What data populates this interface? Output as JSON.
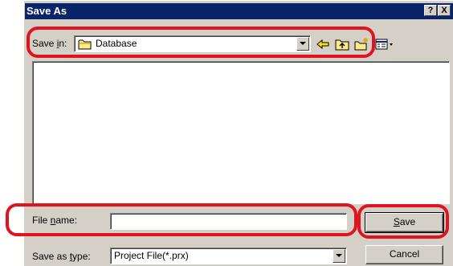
{
  "window": {
    "title": "Save As",
    "help_button": "?",
    "close_button": "X"
  },
  "save_in": {
    "label_pre": "Save ",
    "label_access": "i",
    "label_post": "n:",
    "value": "Database"
  },
  "file_name": {
    "label_pre": "File ",
    "label_access": "n",
    "label_post": "ame:",
    "value": ""
  },
  "save_as_type": {
    "label_pre": "Save as ",
    "label_access": "t",
    "label_post": "ype:",
    "value": "Project File(*.prx)"
  },
  "buttons": {
    "save_access": "S",
    "save_rest": "ave",
    "cancel": "Cancel"
  },
  "icons": {
    "back": "back-arrow-icon",
    "up": "up-folder-icon",
    "new_folder": "new-folder-icon",
    "view_menu": "view-menu-icon",
    "folder": "folder-icon"
  },
  "colors": {
    "titlebar": "#0a246a",
    "face": "#d4d0c8",
    "annotation": "#e0141e"
  }
}
